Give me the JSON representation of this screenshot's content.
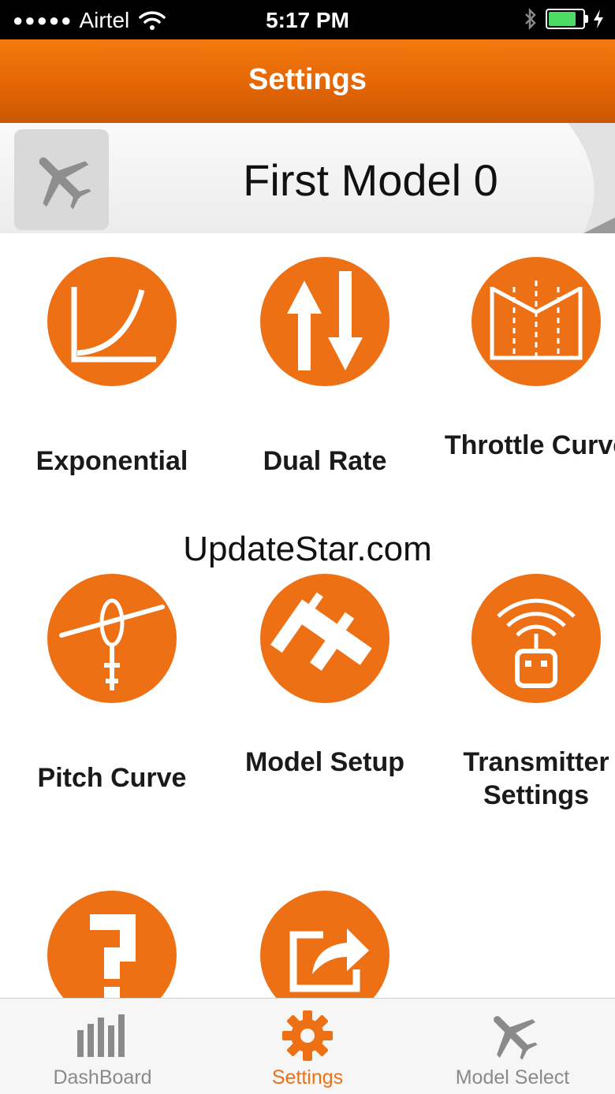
{
  "status_bar": {
    "signal": "●●●●●",
    "carrier": "Airtel",
    "time": "5:17 PM"
  },
  "nav": {
    "title": "Settings"
  },
  "model": {
    "name": "First Model 0",
    "icon": "airplane-icon"
  },
  "grid": [
    {
      "label": "Exponential",
      "icon": "exponential-icon"
    },
    {
      "label": "Dual Rate",
      "icon": "dual-rate-icon"
    },
    {
      "label": "Throttle Curve",
      "icon": "throttle-curve-icon"
    },
    {
      "label": "Pitch Curve",
      "icon": "helicopter-icon"
    },
    {
      "label": "Model Setup",
      "icon": "caliper-icon"
    },
    {
      "label": "Transmitter Settings",
      "icon": "transmitter-icon"
    },
    {
      "label": "",
      "icon": "help-icon"
    },
    {
      "label": "",
      "icon": "share-icon"
    }
  ],
  "watermark": "UpdateStar.com",
  "tabs": [
    {
      "label": "DashBoard",
      "icon": "bar-chart-icon"
    },
    {
      "label": "Settings",
      "icon": "gear-icon"
    },
    {
      "label": "Model Select",
      "icon": "airplane-icon"
    }
  ],
  "colors": {
    "accent": "#ee7015",
    "nav": "#e46604",
    "battery": "#4cd964",
    "inactive_tab": "#8a8a8a"
  }
}
